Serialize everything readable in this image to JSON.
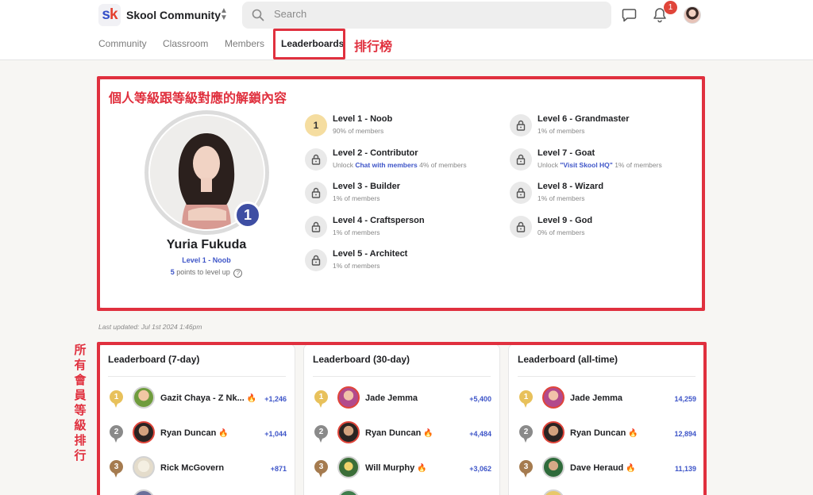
{
  "header": {
    "logo_text": "sk",
    "community_name": "Skool Community",
    "search_placeholder": "Search",
    "notification_count": "1"
  },
  "nav": {
    "tabs": [
      {
        "label": "Community"
      },
      {
        "label": "Classroom"
      },
      {
        "label": "Members"
      },
      {
        "label": "Leaderboards",
        "active": true
      }
    ]
  },
  "annotations": {
    "leaderboards_tab": "排行榜",
    "levels_box": "個人等級跟等級對應的解鎖內容",
    "rankings_box": [
      "所",
      "有",
      "會",
      "員",
      "等",
      "級",
      "排",
      "行"
    ]
  },
  "profile": {
    "name": "Yuria Fukuda",
    "level_label": "Level 1 - Noob",
    "level_number": "1",
    "points": "5",
    "points_suffix": "points to level up",
    "help_icon": "?"
  },
  "levels": [
    {
      "name": "Level 1 - Noob",
      "pre": "",
      "link": "",
      "post": "90% of members",
      "current_number": "1",
      "locked": false
    },
    {
      "name": "Level 2 - Contributor",
      "pre": "Unlock ",
      "link": "Chat with members",
      "post": " 4% of members",
      "locked": true
    },
    {
      "name": "Level 3 - Builder",
      "pre": "",
      "link": "",
      "post": "1% of members",
      "locked": true
    },
    {
      "name": "Level 4 - Craftsperson",
      "pre": "",
      "link": "",
      "post": "1% of members",
      "locked": true
    },
    {
      "name": "Level 5 - Architect",
      "pre": "",
      "link": "",
      "post": "1% of members",
      "locked": true
    },
    {
      "name": "Level 6 - Grandmaster",
      "pre": "",
      "link": "",
      "post": "1% of members",
      "locked": true
    },
    {
      "name": "Level 7 - Goat",
      "pre": "Unlock ",
      "link": "\"Visit Skool HQ\"",
      "post": " 1% of members",
      "locked": true
    },
    {
      "name": "Level 8 - Wizard",
      "pre": "",
      "link": "",
      "post": "1% of members",
      "locked": true
    },
    {
      "name": "Level 9 - God",
      "pre": "",
      "link": "",
      "post": "0% of members",
      "locked": true
    }
  ],
  "last_updated": "Last updated: Jul 1st 2024 1:46pm",
  "colors": {
    "accent_blue": "#3e55c8",
    "annotation_red": "#e0303e",
    "gold": "#e8c15b",
    "silver": "#8a8a8a",
    "bronze": "#a57b4f"
  },
  "leaderboards": [
    {
      "title": "Leaderboard (7-day)",
      "rows": [
        {
          "rank": "1",
          "name": "Gazit Chaya - Z Nk...",
          "fire": true,
          "points": "+1,246"
        },
        {
          "rank": "2",
          "name": "Ryan Duncan",
          "fire": true,
          "points": "+1,044"
        },
        {
          "rank": "3",
          "name": "Rick McGovern",
          "fire": false,
          "points": "+871"
        }
      ]
    },
    {
      "title": "Leaderboard (30-day)",
      "rows": [
        {
          "rank": "1",
          "name": "Jade Jemma",
          "fire": false,
          "points": "+5,400"
        },
        {
          "rank": "2",
          "name": "Ryan Duncan",
          "fire": true,
          "points": "+4,484"
        },
        {
          "rank": "3",
          "name": "Will Murphy",
          "fire": true,
          "points": "+3,062"
        }
      ]
    },
    {
      "title": "Leaderboard (all-time)",
      "rows": [
        {
          "rank": "1",
          "name": "Jade Jemma",
          "fire": false,
          "points": "14,259"
        },
        {
          "rank": "2",
          "name": "Ryan Duncan",
          "fire": true,
          "points": "12,894"
        },
        {
          "rank": "3",
          "name": "Dave Heraud",
          "fire": true,
          "points": "11,139"
        }
      ]
    }
  ]
}
